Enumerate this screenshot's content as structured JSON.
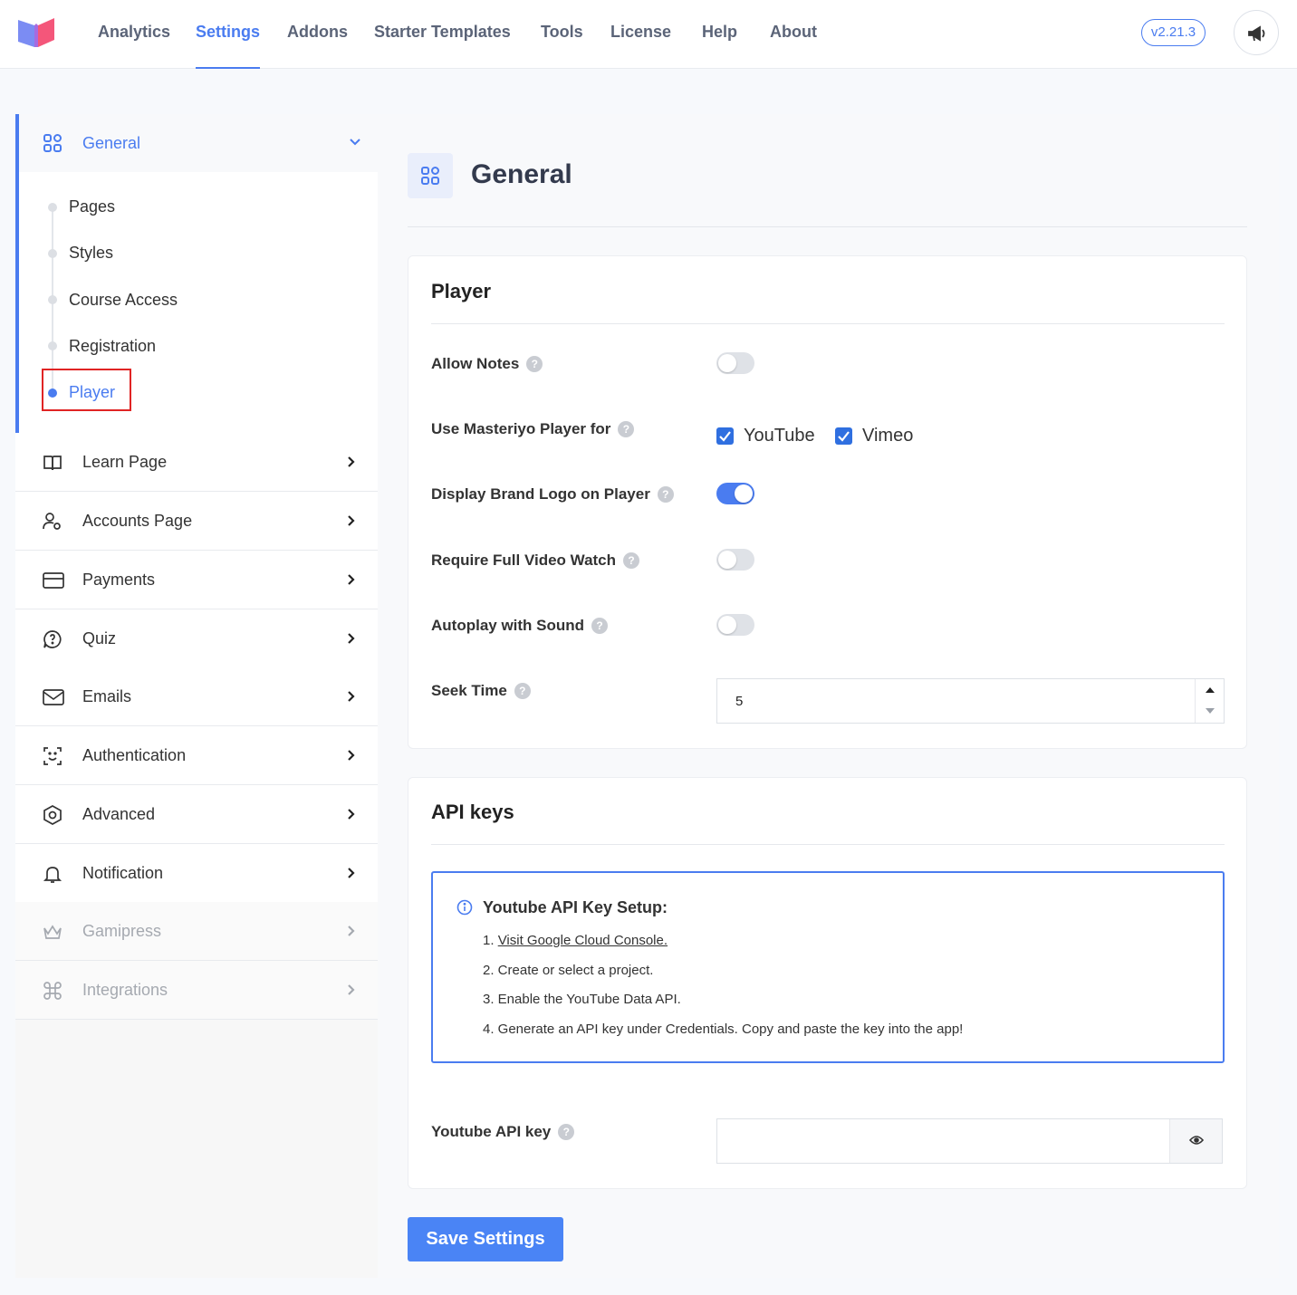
{
  "nav": {
    "items": [
      "Analytics",
      "Settings",
      "Addons",
      "Starter Templates",
      "Tools",
      "License",
      "Help",
      "About"
    ],
    "active": "Settings",
    "version": "v2.21.3"
  },
  "sidebar": {
    "general": {
      "label": "General",
      "subitems": [
        "Pages",
        "Styles",
        "Course Access",
        "Registration",
        "Player"
      ],
      "active": "Player"
    },
    "items": [
      {
        "label": "Learn Page",
        "icon": "book-icon"
      },
      {
        "label": "Accounts Page",
        "icon": "user-settings-icon"
      },
      {
        "label": "Payments",
        "icon": "credit-card-icon"
      },
      {
        "label": "Quiz",
        "icon": "quiz-icon"
      },
      {
        "label": "Emails",
        "icon": "mail-icon"
      },
      {
        "label": "Authentication",
        "icon": "face-scan-icon"
      },
      {
        "label": "Advanced",
        "icon": "hexagon-gear-icon"
      },
      {
        "label": "Notification",
        "icon": "bell-icon"
      },
      {
        "label": "Gamipress",
        "icon": "crown-icon"
      },
      {
        "label": "Integrations",
        "icon": "command-icon"
      }
    ]
  },
  "main": {
    "title": "General",
    "player": {
      "title": "Player",
      "allow_notes": {
        "label": "Allow Notes",
        "on": false
      },
      "use_player_for": {
        "label": "Use Masteriyo Player for",
        "youtube": "YouTube",
        "vimeo": "Vimeo",
        "youtube_checked": true,
        "vimeo_checked": true
      },
      "brand_logo": {
        "label": "Display Brand Logo on Player",
        "on": true
      },
      "full_watch": {
        "label": "Require Full Video Watch",
        "on": false
      },
      "autoplay": {
        "label": "Autoplay with Sound",
        "on": false
      },
      "seek_time": {
        "label": "Seek Time",
        "value": "5"
      }
    },
    "api": {
      "title": "API keys",
      "info_title": "Youtube API Key Setup:",
      "step1_prefix": "1. ",
      "step1_link": "Visit Google Cloud Console.",
      "step2": "2. Create or select a project.",
      "step3": "3. Enable the YouTube Data API.",
      "step4": "4. Generate an API key under Credentials. Copy and paste the key into the app!",
      "key_label": "Youtube API key",
      "key_value": ""
    },
    "save_label": "Save Settings"
  },
  "colors": {
    "accent": "#4a7cf0",
    "highlight": "#e02424"
  }
}
